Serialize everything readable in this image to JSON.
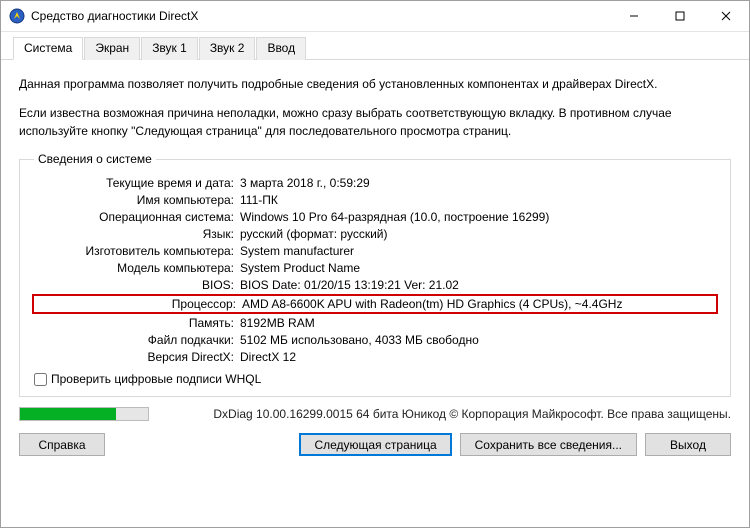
{
  "window": {
    "title": "Средство диагностики DirectX"
  },
  "tabs": {
    "t0": "Система",
    "t1": "Экран",
    "t2": "Звук 1",
    "t3": "Звук 2",
    "t4": "Ввод"
  },
  "intro1": "Данная программа позволяет получить подробные сведения об установленных компонентах и драйверах DirectX.",
  "intro2": "Если известна возможная причина неполадки, можно сразу выбрать соответствующую вкладку. В противном случае используйте кнопку \"Следующая страница\" для последовательного просмотра страниц.",
  "sysinfo": {
    "legend": "Сведения о системе",
    "labels": {
      "datetime": "Текущие время и дата:",
      "computer_name": "Имя компьютера:",
      "os": "Операционная система:",
      "language": "Язык:",
      "manufacturer": "Изготовитель компьютера:",
      "model": "Модель компьютера:",
      "bios": "BIOS:",
      "processor": "Процессор:",
      "memory": "Память:",
      "pagefile": "Файл подкачки:",
      "directx": "Версия DirectX:"
    },
    "values": {
      "datetime": "3 марта 2018 г., 0:59:29",
      "computer_name": "111-ПК",
      "os": "Windows 10 Pro 64-разрядная (10.0, построение 16299)",
      "language": "русский (формат: русский)",
      "manufacturer": "System manufacturer",
      "model": "System Product Name",
      "bios": "BIOS Date: 01/20/15 13:19:21 Ver: 21.02",
      "processor": "AMD A8-6600K APU with Radeon(tm) HD Graphics    (4 CPUs), ~4.4GHz",
      "memory": "8192MB RAM",
      "pagefile": "5102 МБ использовано, 4033 МБ свободно",
      "directx": "DirectX 12"
    }
  },
  "whql_label": "Проверить цифровые подписи WHQL",
  "version_line": "DxDiag 10.00.16299.0015 64 бита Юникод © Корпорация Майкрософт. Все права защищены.",
  "buttons": {
    "help": "Справка",
    "next": "Следующая страница",
    "save": "Сохранить все сведения...",
    "exit": "Выход"
  },
  "progress_percent": 75
}
